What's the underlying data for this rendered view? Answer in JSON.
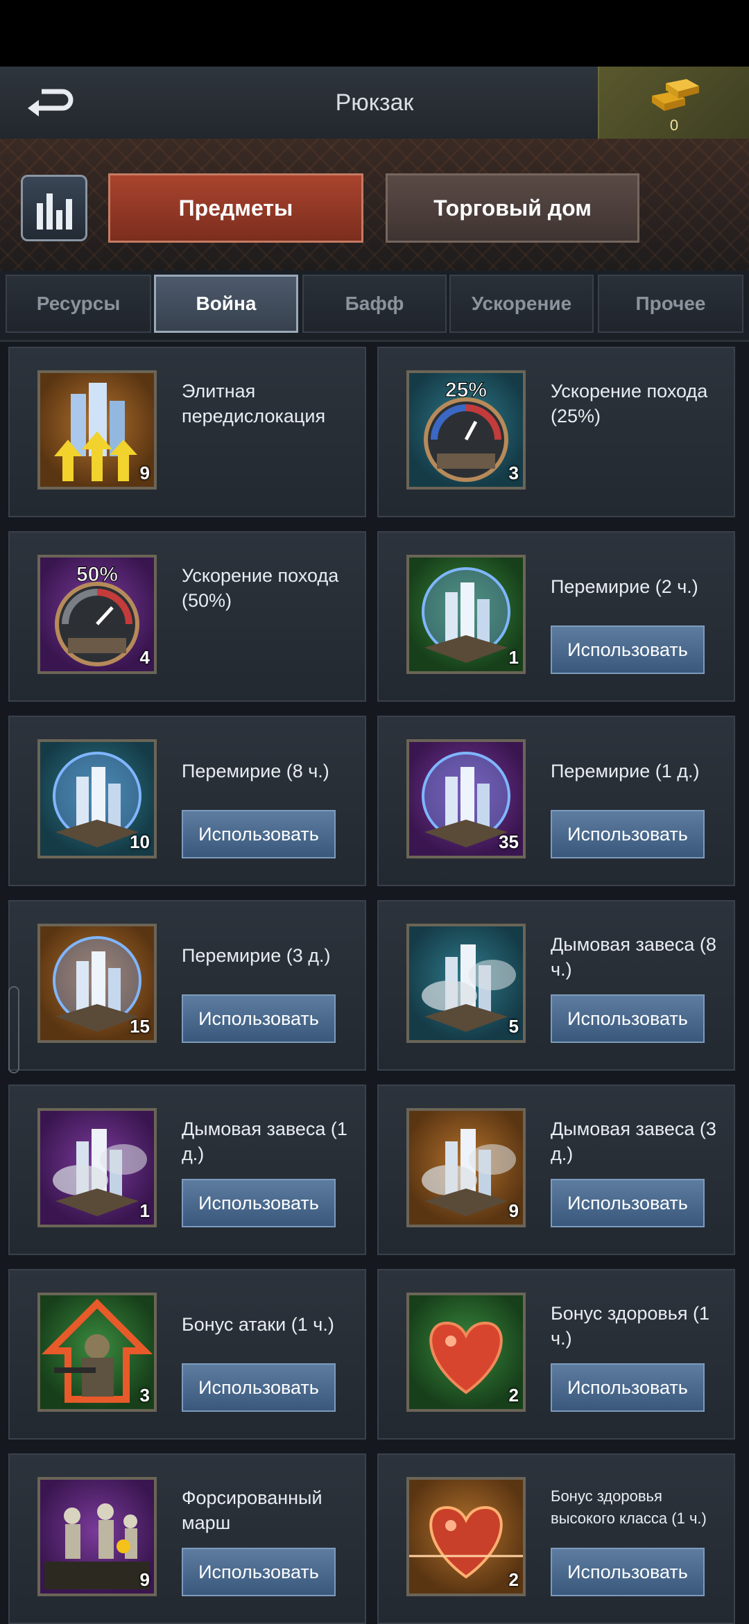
{
  "header": {
    "title": "Рюкзак",
    "gold_count": "0"
  },
  "main_tabs": {
    "items_label": "Предметы",
    "trade_label": "Торговый дом"
  },
  "sub_tabs": [
    {
      "label": "Ресурсы"
    },
    {
      "label": "Война"
    },
    {
      "label": "Бафф"
    },
    {
      "label": "Ускорение"
    },
    {
      "label": "Прочее"
    }
  ],
  "use_label": "Использовать",
  "items": [
    {
      "name": "Элитная передислокация",
      "count": "9",
      "icon": "elite-relocation-icon"
    },
    {
      "name": "Ускорение похода (25%)",
      "count": "3",
      "icon": "march-speedup-25-icon",
      "badge": "25%"
    },
    {
      "name": "Ускорение похода (50%)",
      "count": "4",
      "icon": "march-speedup-50-icon",
      "badge": "50%"
    },
    {
      "name": "Перемирие (2 ч.)",
      "count": "1",
      "icon": "truce-shield-icon"
    },
    {
      "name": "Перемирие (8 ч.)",
      "count": "10",
      "icon": "truce-shield-icon"
    },
    {
      "name": "Перемирие (1 д.)",
      "count": "35",
      "icon": "truce-shield-icon"
    },
    {
      "name": "Перемирие (3 д.)",
      "count": "15",
      "icon": "truce-shield-icon"
    },
    {
      "name": "Дымовая завеса (8 ч.)",
      "count": "5",
      "icon": "smoke-screen-icon"
    },
    {
      "name": "Дымовая завеса (1 д.)",
      "count": "1",
      "icon": "smoke-screen-icon"
    },
    {
      "name": "Дымовая завеса (3 д.)",
      "count": "9",
      "icon": "smoke-screen-icon"
    },
    {
      "name": "Бонус атаки (1 ч.)",
      "count": "3",
      "icon": "attack-bonus-icon"
    },
    {
      "name": "Бонус здоровья (1 ч.)",
      "count": "2",
      "icon": "health-bonus-icon"
    },
    {
      "name": "Форсированный марш",
      "count": "9",
      "icon": "forced-march-icon"
    },
    {
      "name": "Бонус здоровья высокого класса (1 ч.)",
      "count": "2",
      "icon": "advanced-health-bonus-icon"
    }
  ]
}
